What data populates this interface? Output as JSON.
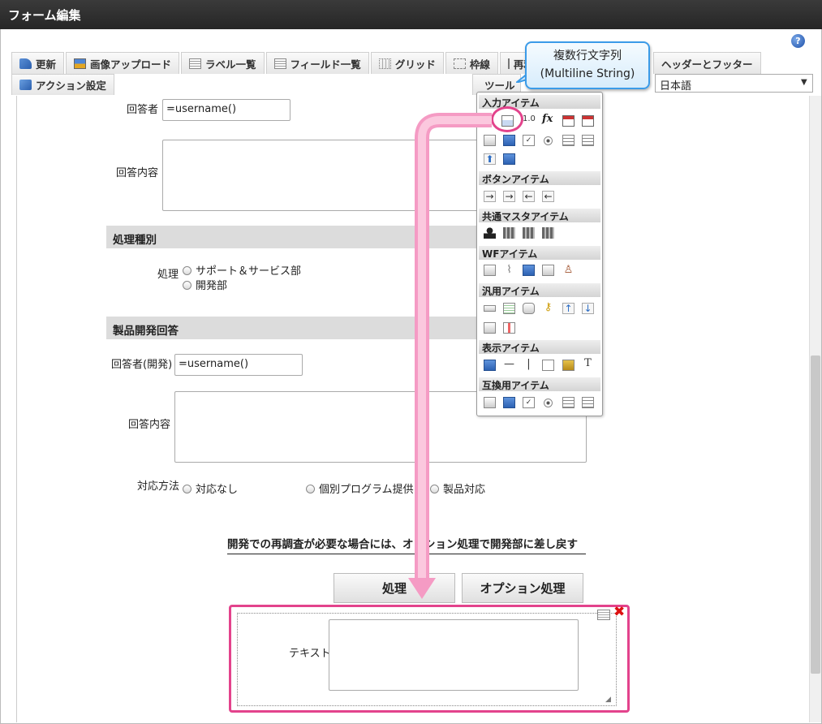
{
  "window": {
    "title": "フォーム編集"
  },
  "toolbar": {
    "row1": [
      "更新",
      "画像アップロード",
      "ラベル一覧",
      "フィールド一覧",
      "グリッド",
      "枠線",
      "再利",
      "ヘッダーとフッター"
    ],
    "row2": [
      "アクション設定",
      "ツール"
    ],
    "language": "日本語"
  },
  "tooltip": {
    "line1": "複数行文字列",
    "line2": "(Multiline String)"
  },
  "form": {
    "respondent_label": "回答者",
    "respondent_value": "=username()",
    "answer_content_label": "回答内容",
    "section_processing": "処理種別",
    "processing_label": "処理",
    "processing_options": [
      "サポート＆サービス部",
      "開発部"
    ],
    "section_product_dev": "製品開発回答",
    "respondent_dev_label": "回答者(開発)",
    "respondent_dev_value": "=username()",
    "answer_content_label2": "回答内容",
    "response_method_label": "対応方法",
    "response_options": [
      "対応なし",
      "個別プログラム提供",
      "製品対応"
    ],
    "note": "開発での再調査が必要な場合には、オプション処理で開発部に差し戻す",
    "buttons": {
      "process": "処理",
      "option_process": "オプション処理"
    },
    "new_field_label": "テキスト"
  },
  "palette": {
    "sections": [
      "入力アイテム",
      "ボタンアイテム",
      "共通マスタアイテム",
      "WFアイテム",
      "汎用アイテム",
      "表示アイテム",
      "互換用アイテム"
    ]
  },
  "colors": {
    "highlight": "#e3438c",
    "tooltip_border": "#3b9be8",
    "titlebar": "#2e2e2e"
  }
}
